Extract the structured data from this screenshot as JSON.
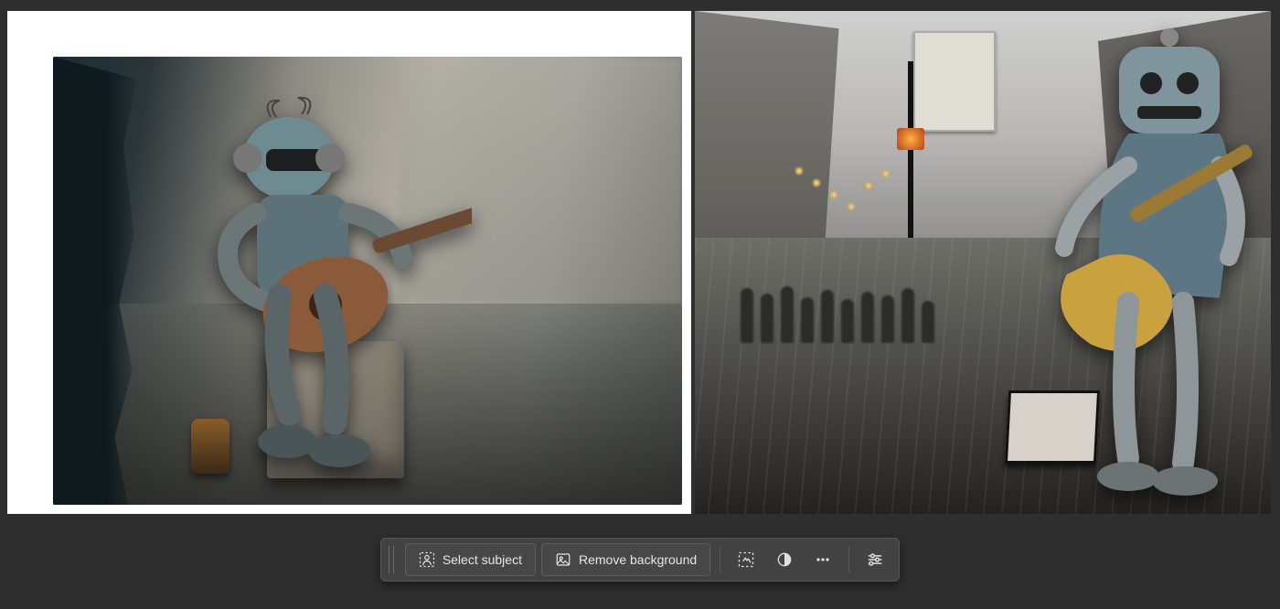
{
  "canvas": {
    "left_alt": "Robot sitting on a crate playing an acoustic guitar on a city street",
    "right_alt": "Metallic robot standing playing an electric guitar on a rainy city street with pedestrians"
  },
  "toolbar": {
    "select_subject_label": "Select subject",
    "remove_background_label": "Remove background",
    "icons": {
      "select_subject": "person-select-icon",
      "remove_background": "image-icon",
      "transform": "transform-select-icon",
      "mask_circle": "mask-circle-icon",
      "more": "more-horizontal-icon",
      "properties": "sliders-icon"
    }
  }
}
